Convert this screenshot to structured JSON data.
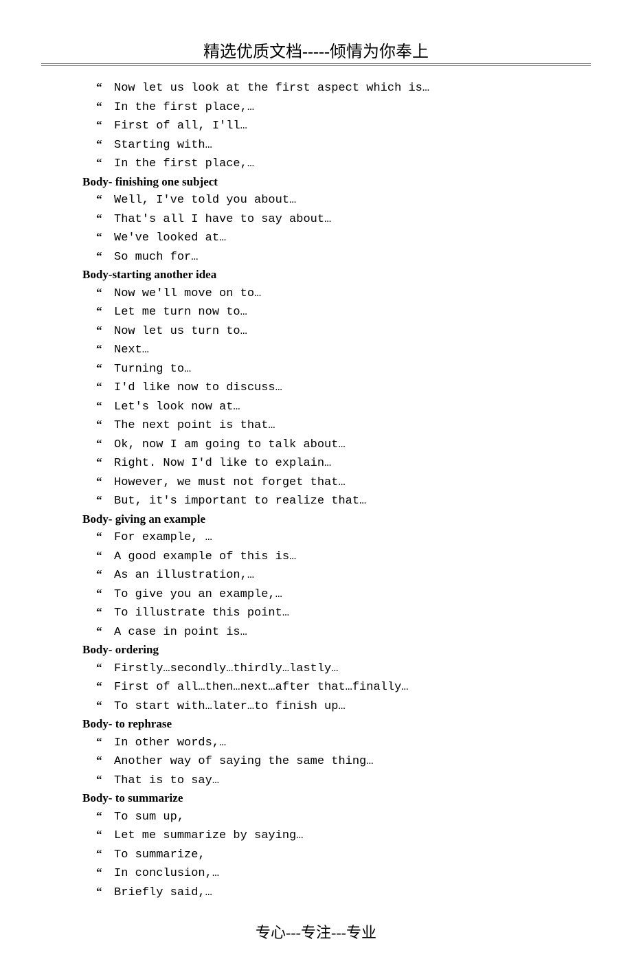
{
  "header": "精选优质文档-----倾情为你奉上",
  "footer": "专心---专注---专业",
  "sections": [
    {
      "heading": null,
      "items": [
        "Now let us look at the first aspect which is…",
        "In the first place,…",
        "First of all, I'll…",
        "Starting with…",
        "In the first place,…"
      ]
    },
    {
      "heading": "Body- finishing one subject",
      "items": [
        "Well, I've told you about…",
        "That's all I have to say about…",
        "We've looked at…",
        "So much for…"
      ]
    },
    {
      "heading": "Body-starting another idea",
      "items": [
        "Now we'll move on to…",
        "Let me turn now to…",
        "Now let us turn to…",
        "Next…",
        "Turning to…",
        "I'd like now to discuss…",
        "Let's look now at…",
        "The next point is that…",
        "Ok, now I am going to talk about…",
        "Right. Now I'd like to explain…",
        "However, we must not forget that…",
        "But, it's important to realize that…"
      ]
    },
    {
      "heading": "Body- giving an example",
      "items": [
        "For example, …",
        "A good example of this is…",
        "As an illustration,…",
        "To give you an example,…",
        "To illustrate this point…",
        "A case in point is…"
      ]
    },
    {
      "heading": "Body- ordering",
      "items": [
        "Firstly…secondly…thirdly…lastly…",
        "First of all…then…next…after that…finally…",
        "To start with…later…to finish up…"
      ]
    },
    {
      "heading": "Body- to rephrase",
      "items": [
        "In other words,…",
        "Another way of saying the same thing…",
        "That is to say…"
      ]
    },
    {
      "heading": "Body- to summarize",
      "items": [
        "To sum up,",
        "Let me summarize by saying…",
        "To summarize,",
        "In conclusion,…",
        "Briefly said,…"
      ]
    }
  ]
}
